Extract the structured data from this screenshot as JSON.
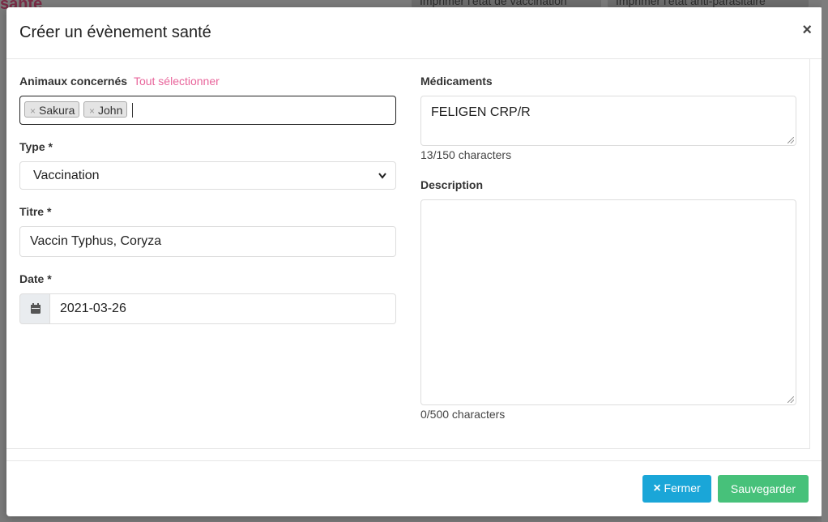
{
  "background": {
    "button_1": "Imprimer l'état de vaccination",
    "button_2": "Imprimer l'état anti-parasitaire",
    "heading_fragment": "santé"
  },
  "modal": {
    "title": "Créer un évènement santé",
    "close_glyph": "×"
  },
  "animals": {
    "label": "Animaux concernés",
    "select_all_link": "Tout sélectionner",
    "tags": [
      {
        "remove": "×",
        "name": "Sakura"
      },
      {
        "remove": "×",
        "name": "John"
      }
    ]
  },
  "type": {
    "label": "Type *",
    "value": "Vaccination",
    "chevron": "⌄"
  },
  "titre": {
    "label": "Titre *",
    "value": "Vaccin Typhus, Coryza"
  },
  "date": {
    "label": "Date *",
    "value": "2021-03-26",
    "icon": "calendar-icon"
  },
  "medicaments": {
    "label": "Médicaments",
    "value": "FELIGEN CRP/R",
    "counter": "13/150 characters"
  },
  "description": {
    "label": "Description",
    "value": "",
    "counter": "0/500 characters"
  },
  "footer": {
    "close_label": "Fermer",
    "close_icon": "×",
    "save_label": "Sauvegarder"
  },
  "colors": {
    "link": "#e8659b",
    "close_button": "#1aa6d8",
    "save_button": "#47c17a"
  }
}
